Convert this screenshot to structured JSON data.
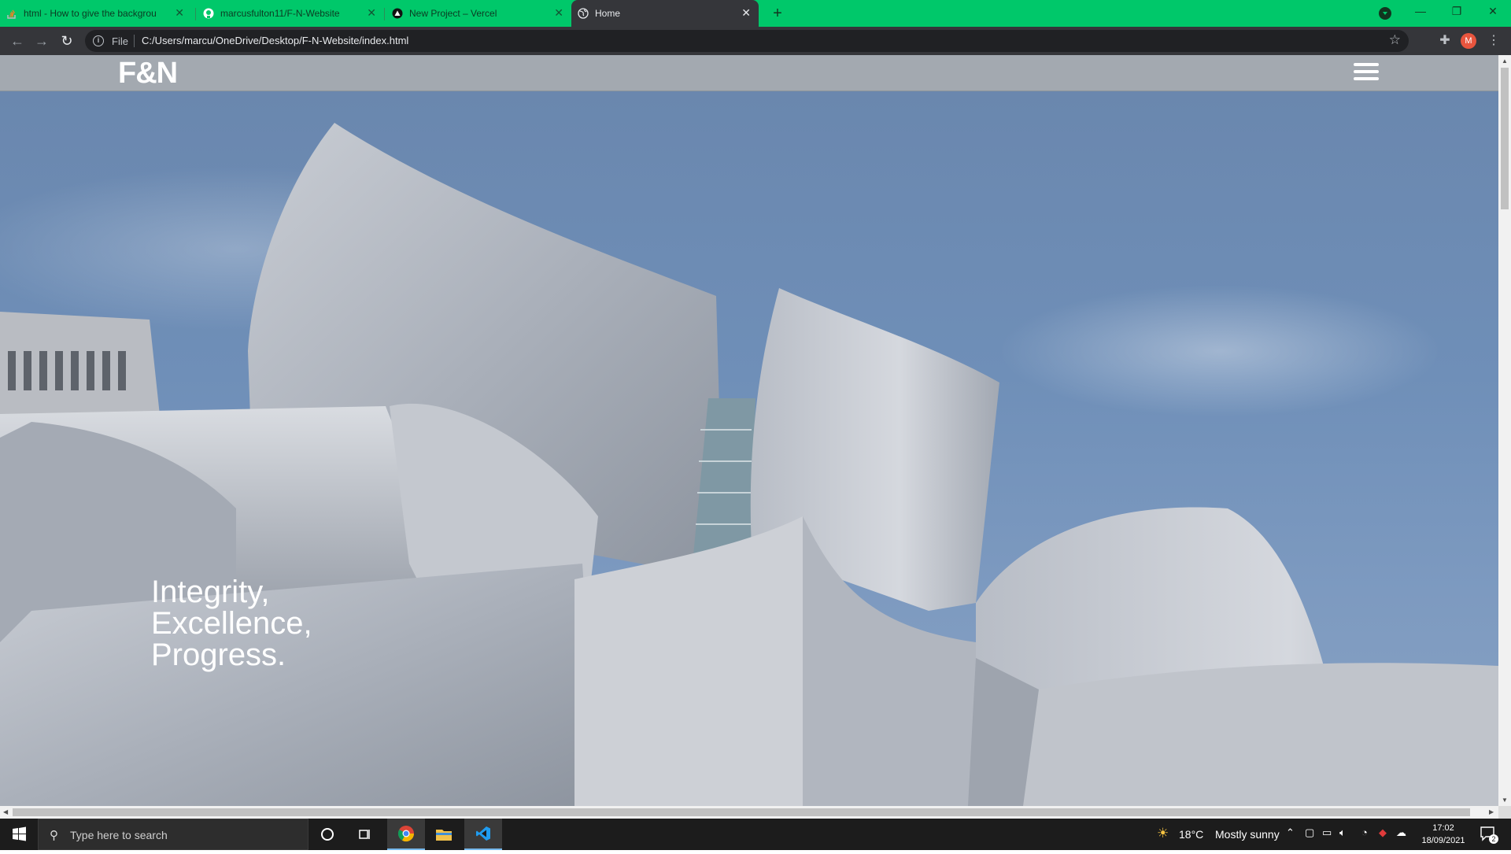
{
  "browser": {
    "tabs": [
      {
        "title": "html - How to give the backgrou",
        "icon": "stackoverflow-icon",
        "active": false
      },
      {
        "title": "marcusfulton11/F-N-Website",
        "icon": "github-icon",
        "active": false
      },
      {
        "title": "New Project – Vercel",
        "icon": "vercel-icon",
        "active": false
      },
      {
        "title": "Home",
        "icon": "globe-icon",
        "active": true
      }
    ],
    "new_tab_label": "+",
    "address": {
      "scheme_label": "File",
      "url": "C:/Users/marcu/OneDrive/Desktop/F-N-Website/index.html"
    },
    "profile_initial": "M",
    "colors": {
      "tabstrip": "#00c86a",
      "toolbar": "#35363a",
      "omnibox": "#202124"
    }
  },
  "page": {
    "logo": "F&N",
    "tagline": [
      "Integrity,",
      "Excellence,",
      "Progress."
    ],
    "colors": {
      "navbar": "#a3a9b0",
      "text": "#ffffff"
    }
  },
  "taskbar": {
    "search_placeholder": "Type here to search",
    "weather": {
      "temp": "18°C",
      "condition": "Mostly sunny"
    },
    "clock": {
      "time": "17:02",
      "date": "18/09/2021"
    },
    "notification_count": "2",
    "pinned": [
      "cortana-icon",
      "task-view-icon",
      "chrome-icon",
      "file-explorer-icon",
      "vscode-icon"
    ]
  }
}
